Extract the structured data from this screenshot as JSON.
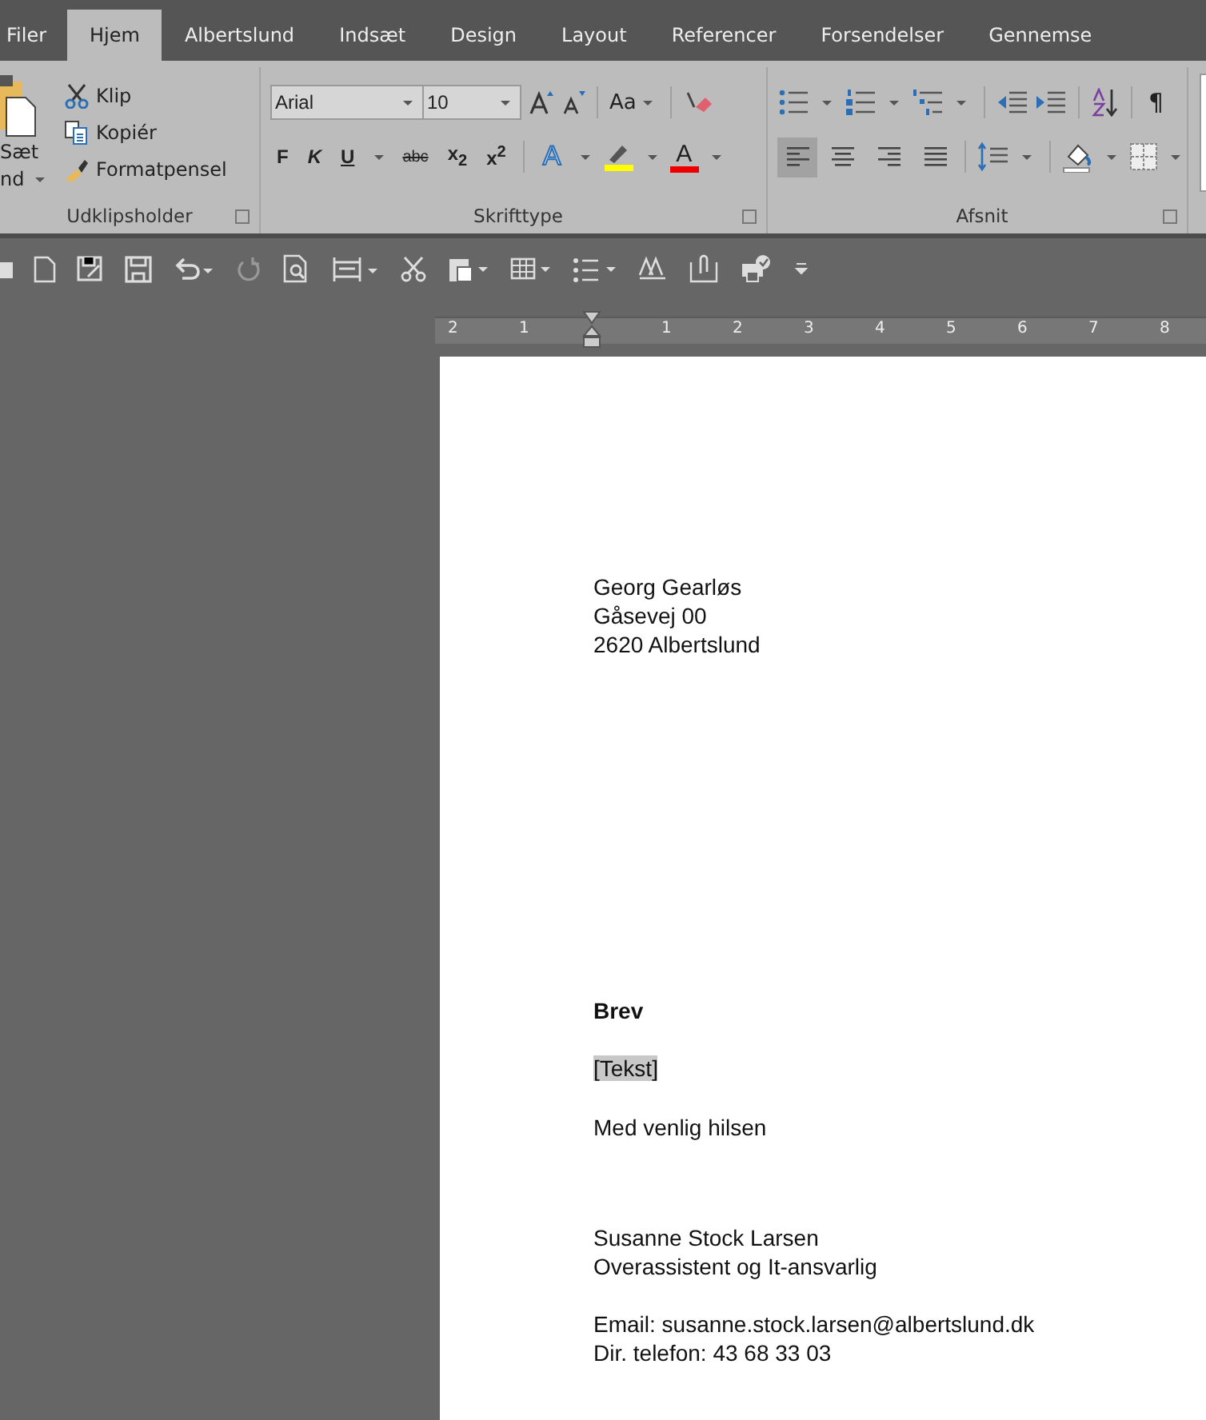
{
  "tabs": [
    {
      "label": "Filer",
      "selected": false
    },
    {
      "label": "Hjem",
      "selected": true
    },
    {
      "label": "Albertslund",
      "selected": false
    },
    {
      "label": "Indsæt",
      "selected": false
    },
    {
      "label": "Design",
      "selected": false
    },
    {
      "label": "Layout",
      "selected": false
    },
    {
      "label": "Referencer",
      "selected": false
    },
    {
      "label": "Forsendelser",
      "selected": false
    },
    {
      "label": "Gennemse",
      "selected": false
    }
  ],
  "clipboard": {
    "title": "Udklipsholder",
    "paste_lines": [
      "Sæt",
      "nd"
    ],
    "buttons": [
      "Klip",
      "Kopiér",
      "Formatpensel"
    ]
  },
  "font": {
    "title": "Skrifttype",
    "font_name": "Arial",
    "font_size": "10",
    "case_button": "Aa",
    "format_buttons": [
      "F",
      "K",
      "U",
      "abc",
      "x$_{2}$",
      "x$^{2}$"
    ],
    "effects_button": "A",
    "color_button": "A"
  },
  "paragraph": {
    "title": "Afsnit",
    "pilcrow": "¶",
    "align": [
      {
        "kind": "left",
        "selected": true
      },
      {
        "kind": "center",
        "selected": false
      },
      {
        "kind": "right",
        "selected": false
      },
      {
        "kind": "justify",
        "selected": false
      }
    ]
  },
  "ruler": [
    "2",
    "1",
    "1",
    "2",
    "3",
    "4",
    "5",
    "6",
    "7",
    "8"
  ],
  "document": [
    {
      "kind": "address",
      "lines": [
        "Georg Gearløs",
        "Gåsevej 00",
        "2620 Albertslund"
      ]
    },
    {
      "kind": "subject",
      "lines": [
        "Brev"
      ]
    },
    {
      "kind": "placeholder",
      "lines": [
        "[Tekst]"
      ]
    },
    {
      "kind": "text",
      "lines": [
        "Med venlig hilsen"
      ]
    },
    {
      "kind": "signature",
      "lines": [
        "Susanne Stock Larsen",
        "Overassistent og It-ansvarlig"
      ]
    },
    {
      "kind": "contact",
      "lines": [
        "Email: susanne.stock.larsen@albertslund.dk",
        "Dir. telefon: 43 68 33 03"
      ]
    }
  ]
}
